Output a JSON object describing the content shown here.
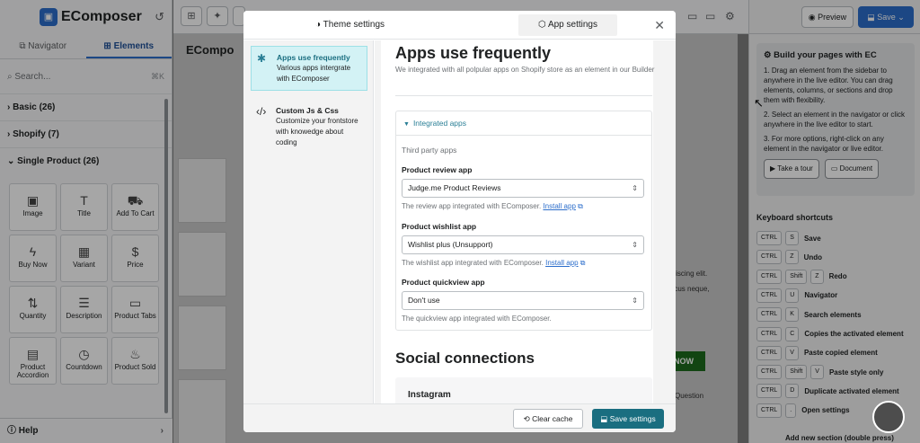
{
  "app": {
    "brand": "EComposer"
  },
  "left": {
    "tabs": [
      "Navigator",
      "Elements"
    ],
    "search_placeholder": "Search...",
    "search_shortcut": "⌘K",
    "categories": [
      "Basic (26)",
      "Shopify (7)",
      "Single Product (26)"
    ],
    "elements": [
      "Image",
      "Title",
      "Add To Cart",
      "Buy Now",
      "Variant",
      "Price",
      "Quantity",
      "Description",
      "Product Tabs",
      "Product Accordion",
      "Countdown",
      "Product Sold"
    ],
    "help": "Help"
  },
  "canvas": {
    "shop_logo": "ECompo",
    "text1": "adipiscing elit.",
    "text2": "honcus neque,",
    "text3": "Question",
    "green_btn": "NOW"
  },
  "right": {
    "preview": "Preview",
    "save": "Save",
    "guide_title": "Build your pages with EC",
    "guide_steps": [
      "1. Drag an element from the sidebar to anywhere in the live editor. You can drag elements, columns, or sections and drop them with flexibility.",
      "2. Select an element in the navigator or click anywhere in the live editor to start.",
      "3. For more options, right-click on any element in the navigator or live editor."
    ],
    "take_tour": "Take a tour",
    "document": "Document",
    "shortcuts_title": "Keyboard shortcuts",
    "shortcuts": [
      {
        "keys": [
          "CTRL",
          "S"
        ],
        "label": "Save"
      },
      {
        "keys": [
          "CTRL",
          "Z"
        ],
        "label": "Undo"
      },
      {
        "keys": [
          "CTRL",
          "Shift",
          "Z"
        ],
        "label": "Redo"
      },
      {
        "keys": [
          "CTRL",
          "U"
        ],
        "label": "Navigator"
      },
      {
        "keys": [
          "CTRL",
          "K"
        ],
        "label": "Search elements"
      },
      {
        "keys": [
          "CTRL",
          "C"
        ],
        "label": "Copies the activated element"
      },
      {
        "keys": [
          "CTRL",
          "V"
        ],
        "label": "Paste copied element"
      },
      {
        "keys": [
          "CTRL",
          "Shift",
          "V"
        ],
        "label": "Paste style only"
      },
      {
        "keys": [
          "CTRL",
          "D"
        ],
        "label": "Duplicate activated element"
      },
      {
        "keys": [
          "CTRL",
          "."
        ],
        "label": "Open settings"
      }
    ],
    "last_shortcut": "Add new section (double press)"
  },
  "modal": {
    "tabs": [
      "Theme settings",
      "App settings"
    ],
    "side": [
      {
        "title": "Apps use frequently",
        "desc": "Various apps intergrate with EComposer"
      },
      {
        "title": "Custom Js & Css",
        "desc": "Customize your frontstore with knowedge about coding"
      }
    ],
    "heading": "Apps use frequently",
    "subheading": "We integrated with all polpular apps on Shopify store as an element in our Builder",
    "panel_title": "Integrated apps",
    "third_party": "Third party apps",
    "review_label": "Product review app",
    "review_value": "Judge.me Product Reviews",
    "review_help": "The review app integrated with EComposer.",
    "wishlist_label": "Product wishlist app",
    "wishlist_value": "Wishlist plus (Unsupport)",
    "wishlist_help": "The wishlist app integrated with EComposer.",
    "quickview_label": "Product quickview app",
    "quickview_value": "Don't use",
    "quickview_help": "The quickview app integrated with EComposer.",
    "install_link": "Install app",
    "social_heading": "Social connections",
    "instagram": "Instagram",
    "clear_cache": "Clear cache",
    "save_settings": "Save settings"
  }
}
